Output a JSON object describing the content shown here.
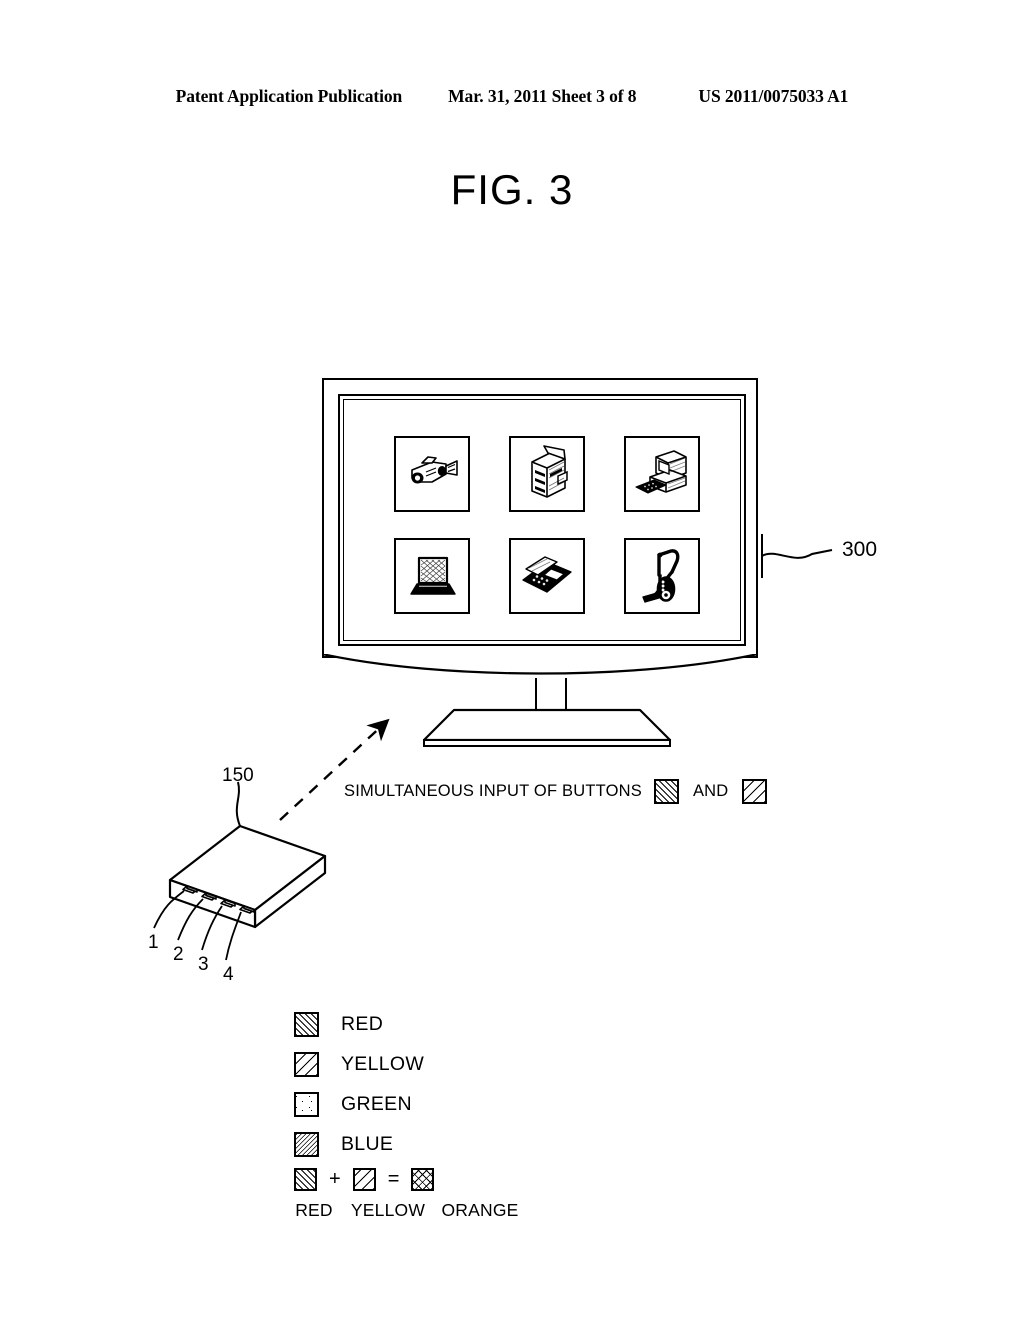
{
  "header": {
    "publication": "Patent Application Publication",
    "date_sheet": "Mar. 31, 2011  Sheet 3 of 8",
    "patent_number": "US 2011/0075033 A1"
  },
  "figure": {
    "title": "FIG. 3"
  },
  "monitor": {
    "reference_label": "300",
    "icons": [
      {
        "name": "camcorder-icon",
        "label": "camcorder"
      },
      {
        "name": "printer-icon",
        "label": "printer"
      },
      {
        "name": "desktop-computer-icon",
        "label": "desktop computer"
      },
      {
        "name": "laptop-icon",
        "label": "laptop"
      },
      {
        "name": "telephone-icon",
        "label": "telephone"
      },
      {
        "name": "vacuum-cleaner-icon",
        "label": "vacuum cleaner"
      }
    ]
  },
  "caption": {
    "text": "SIMULTANEOUS INPUT OF BUTTONS",
    "conjunction": "AND",
    "first_swatch_pattern": "red",
    "second_swatch_pattern": "yellow"
  },
  "remote": {
    "reference_label": "150",
    "button_numbers": [
      "1",
      "2",
      "3",
      "4"
    ]
  },
  "legend": {
    "items": [
      {
        "label": "RED",
        "pattern": "red"
      },
      {
        "label": "YELLOW",
        "pattern": "yellow"
      },
      {
        "label": "GREEN",
        "pattern": "green"
      },
      {
        "label": "BLUE",
        "pattern": "blue"
      }
    ]
  },
  "mix_equation": {
    "plus": "+",
    "equals": "=",
    "operand_a": "RED",
    "operand_b": "YELLOW",
    "result": "ORANGE"
  }
}
